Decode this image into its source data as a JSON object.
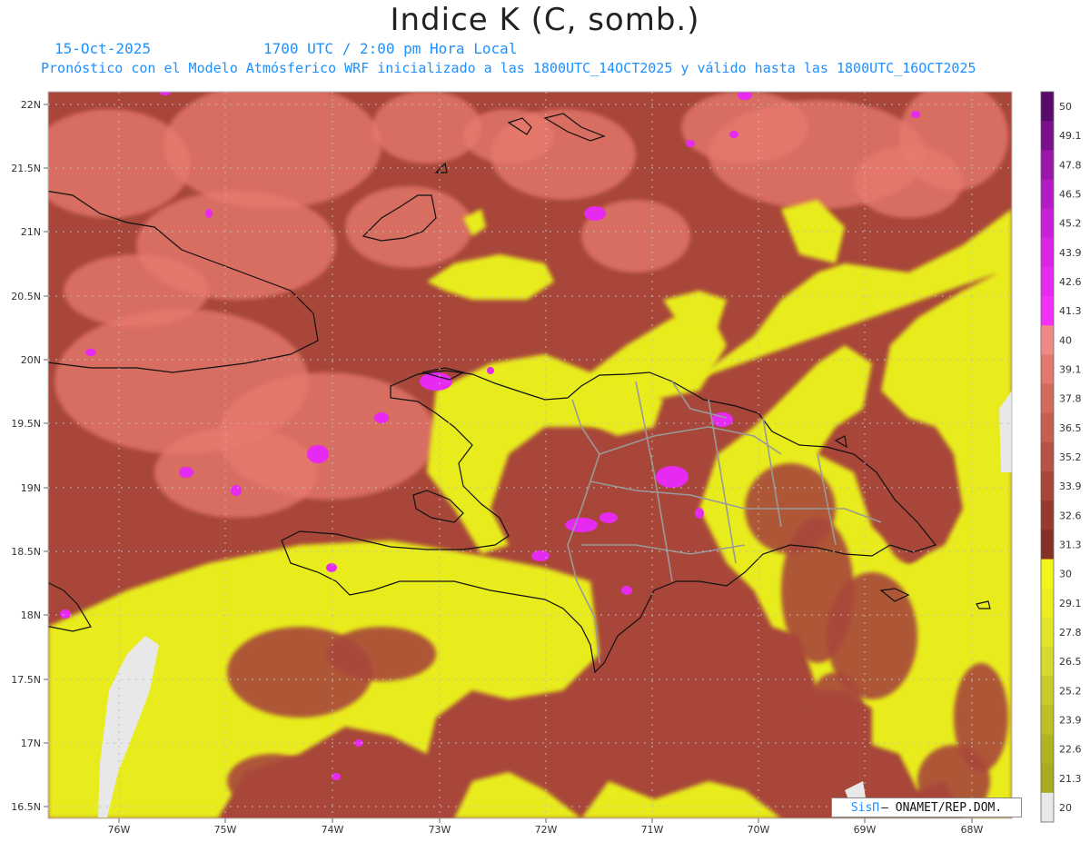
{
  "title": "Indice K (C, somb.)",
  "date": "15-Oct-2025",
  "time_label": "1700 UTC / 2:00 pm Hora Local",
  "subtitle": "Pronóstico con el Modelo Atmósferico WRF inicializado a las 1800UTC_14OCT2025 y válido hasta las  1800UTC_16OCT2025",
  "credit": {
    "brand": "SisΠ",
    "text": "– ONAMET/REP.DOM."
  },
  "lat_labels": [
    "22N",
    "21.5N",
    "21N",
    "20.5N",
    "20N",
    "19.5N",
    "19N",
    "18.5N",
    "18N",
    "17.5N",
    "17N",
    "16.5N"
  ],
  "lon_labels": [
    "76W",
    "75W",
    "74W",
    "73W",
    "72W",
    "71W",
    "70W",
    "69W",
    "68W"
  ],
  "colorbar": {
    "labels": [
      "50",
      "49.1",
      "47.8",
      "46.5",
      "45.2",
      "43.9",
      "42.6",
      "41.3",
      "40",
      "39.1",
      "37.8",
      "36.5",
      "35.2",
      "33.9",
      "32.6",
      "31.3",
      "30",
      "29.1",
      "27.8",
      "26.5",
      "25.2",
      "23.9",
      "22.6",
      "21.3",
      "20"
    ],
    "colors": [
      "#5a0a6a",
      "#7a108a",
      "#9a16aa",
      "#b21cc2",
      "#c820d6",
      "#da24e6",
      "#e62af2",
      "#f230fa",
      "#f08a86",
      "#e2786e",
      "#d36a5e",
      "#c65e52",
      "#b85246",
      "#a8463a",
      "#97392e",
      "#853026",
      "#f2f51a",
      "#ecee20",
      "#e2e52a",
      "#d6da2c",
      "#c8cc2a",
      "#bcc026",
      "#b0b422",
      "#a8aa20",
      "#e8e8e8"
    ]
  },
  "colors": {
    "low": "#e8ec1a",
    "mid": "#e87a6e",
    "high": "#a8463a",
    "peak": "#e62af2",
    "coast": "#111111",
    "borders": "#999999",
    "grid": "#bbbbbb",
    "text_blue": "#1e90ff"
  }
}
